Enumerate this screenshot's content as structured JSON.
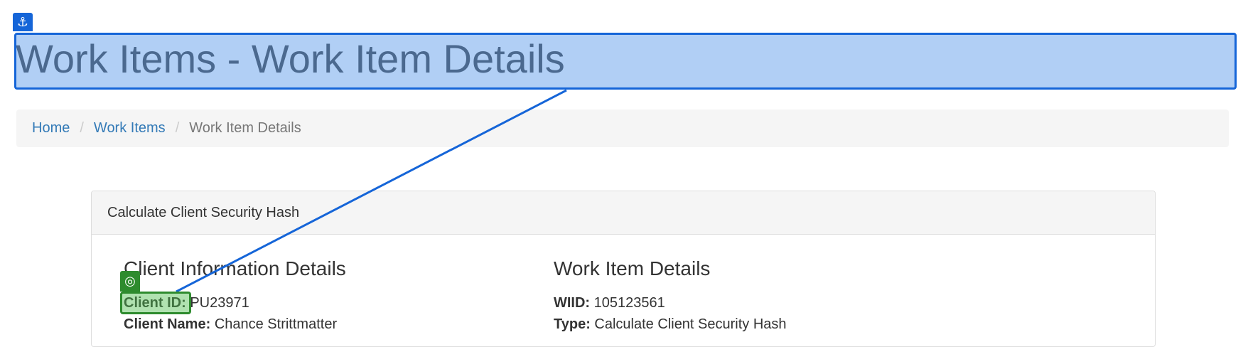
{
  "page": {
    "title": "Work Items - Work Item Details"
  },
  "breadcrumb": {
    "items": [
      {
        "label": "Home"
      },
      {
        "label": "Work Items"
      },
      {
        "label": "Work Item Details"
      }
    ],
    "separator": "/"
  },
  "panel": {
    "heading": "Calculate Client Security Hash",
    "client_section": {
      "title": "Client Information Details",
      "fields": [
        {
          "label": "Client ID:",
          "value": "PU23971"
        },
        {
          "label": "Client Name:",
          "value": "Chance Strittmatter"
        }
      ]
    },
    "work_item_section": {
      "title": "Work Item Details",
      "fields": [
        {
          "label": "WIID:",
          "value": "105123561"
        },
        {
          "label": "Type:",
          "value": "Calculate Client Security Hash"
        }
      ]
    }
  },
  "overlay": {
    "anchor_icon": "anchor-icon",
    "target_icon": "target-icon",
    "anchor_color": "#1565d8",
    "target_color": "#2e8b2e"
  }
}
